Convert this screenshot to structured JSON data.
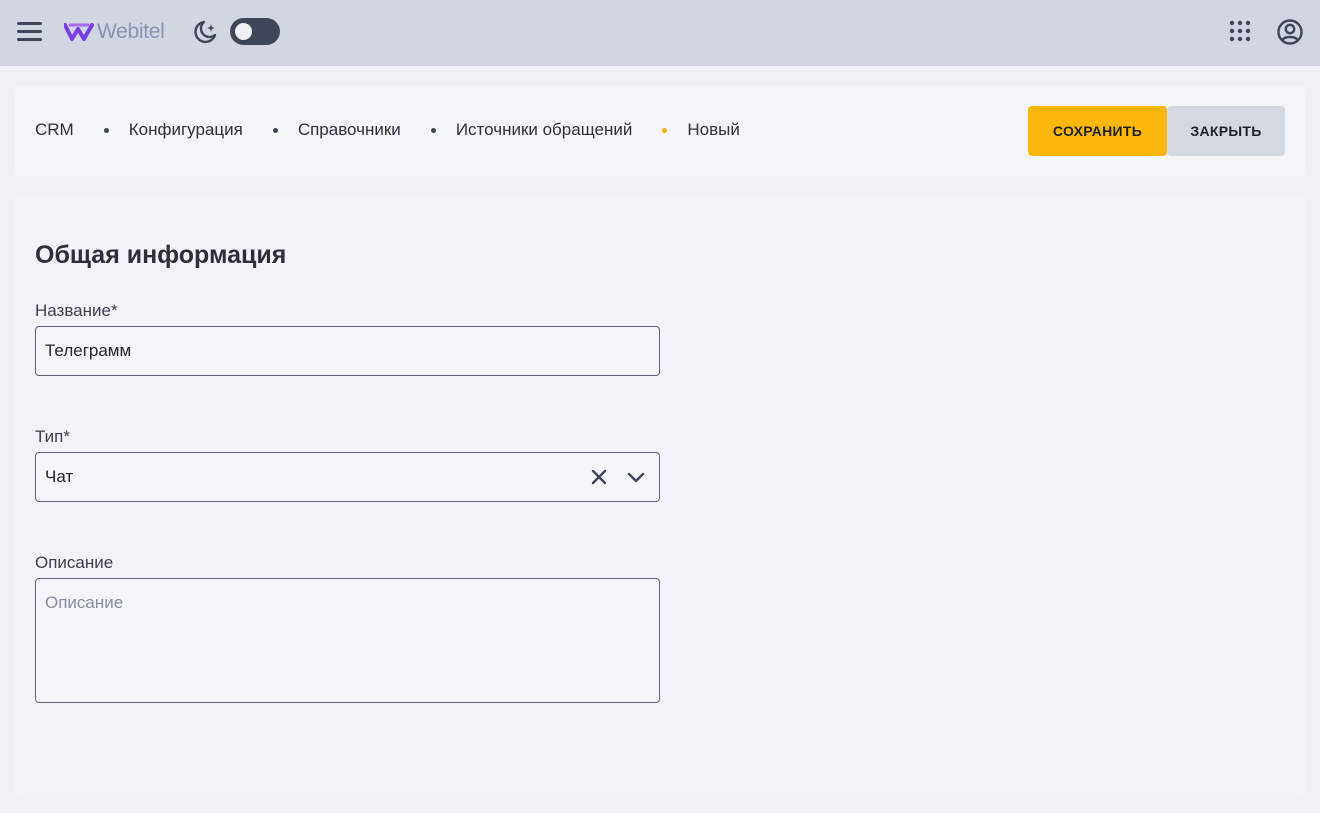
{
  "app": {
    "logo_text": "Webitel"
  },
  "topbar": {
    "icons": [
      "menu-icon",
      "moon-stars-icon",
      "apps-grid-icon",
      "account-circle-icon"
    ],
    "theme_toggle": "off"
  },
  "breadcrumb": {
    "items": [
      "CRM",
      "Конфигурация",
      "Справочники",
      "Источники обращений",
      "Новый"
    ]
  },
  "actions": {
    "save_label": "СОХРАНИТЬ",
    "close_label": "ЗАКРЫТЬ"
  },
  "form": {
    "section_title": "Общая информация",
    "name": {
      "label": "Название*",
      "value": "Телеграмм"
    },
    "type": {
      "label": "Тип*",
      "value": "Чат"
    },
    "description": {
      "label": "Описание",
      "value": "",
      "placeholder": "Описание"
    }
  },
  "colors": {
    "topbar_bg": "#d2d6e0",
    "accent": "#fbb70b",
    "secondary_button": "#d4d8e1",
    "active_crumb_dot": "#f5b20c"
  }
}
